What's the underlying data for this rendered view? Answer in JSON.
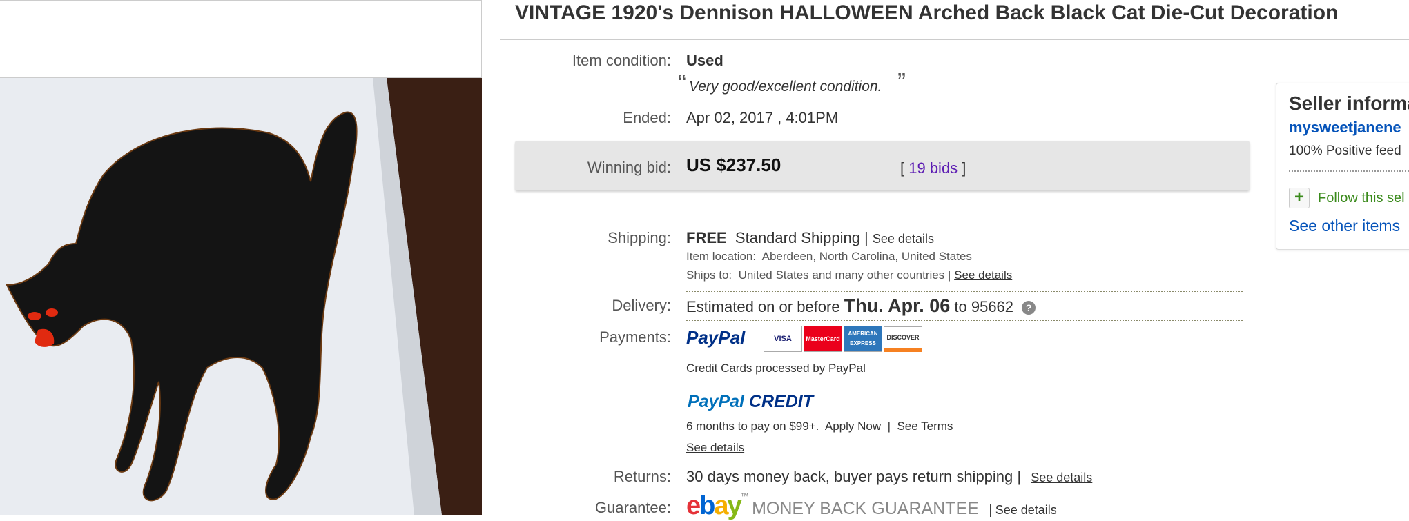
{
  "title": "VINTAGE 1920's Dennison HALLOWEEN Arched Back Black Cat Die-Cut Decoration",
  "condition": {
    "label": "Item condition:",
    "value": "Used",
    "quote_open": "“",
    "quote": "Very good/excellent condition.",
    "quote_close": "”"
  },
  "ended": {
    "label": "Ended:",
    "value": "Apr 02, 2017 , 4:01PM"
  },
  "bid": {
    "label": "Winning bid:",
    "value": "US $237.50",
    "bids_open": "[ ",
    "bids_count": "19 bids",
    "bids_close": " ]"
  },
  "shipping": {
    "label": "Shipping:",
    "free": "FREE",
    "method": "Standard Shipping |",
    "see_details": "See details",
    "location_label": "Item location:",
    "location": "Aberdeen, North Carolina, United States",
    "ships_label": "Ships to:",
    "ships": "United States and many other countries |",
    "ships_details": "See details"
  },
  "delivery": {
    "label": "Delivery:",
    "prefix": "Estimated on or before",
    "date": "Thu. Apr. 06",
    "to": "to",
    "zip": "95662",
    "help": "?"
  },
  "payments": {
    "label": "Payments:",
    "paypal": "PayPal",
    "cards": [
      "VISA",
      "MasterCard",
      "AMERICAN EXPRESS",
      "DISCOVER"
    ],
    "processed": "Credit Cards processed by PayPal",
    "credit_paypal": "PayPal",
    "credit_word": "CREDIT",
    "offer": "6 months to pay on $99+.",
    "apply": "Apply Now",
    "sep": "|",
    "terms": "See Terms",
    "see_details": "See details"
  },
  "returns": {
    "label": "Returns:",
    "value": "30 days money back, buyer pays return shipping |",
    "see_details": "See details"
  },
  "guarantee": {
    "label": "Guarantee:",
    "ebay": [
      "e",
      "b",
      "a",
      "y"
    ],
    "tm": "™",
    "mbg": "MONEY BACK GUARANTEE",
    "sep": "|",
    "see_details": "See details"
  },
  "seller": {
    "heading": "Seller informa",
    "name": "mysweetjanene",
    "feedback": "100% Positive feed",
    "follow": "Follow this sel",
    "other": "See other items"
  },
  "colors": {
    "link_blue": "#0654ba",
    "bids_purple": "#5c1cb3",
    "follow_green": "#3a8a1b",
    "ebay_red": "#e53238",
    "ebay_blue": "#0064d2",
    "ebay_yellow": "#f5af02",
    "ebay_green": "#86b817"
  }
}
